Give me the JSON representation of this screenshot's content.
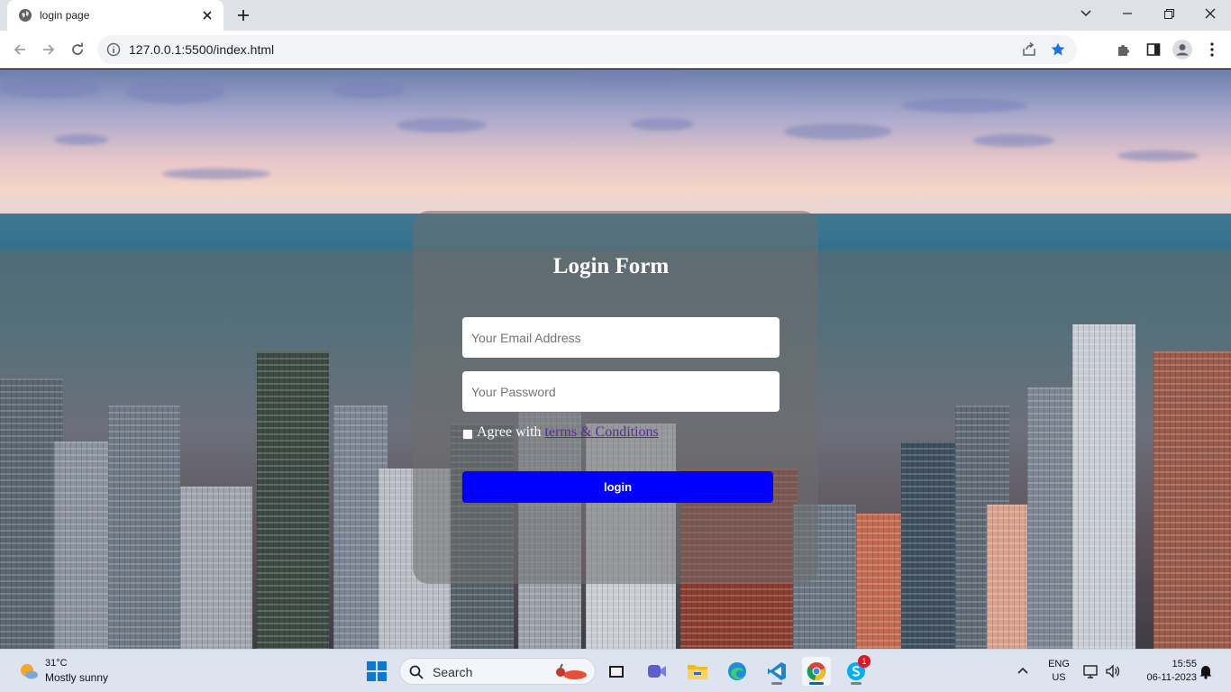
{
  "browser": {
    "tab_title": "login page",
    "url": "127.0.0.1:5500/index.html",
    "accent_star": "#1a73e8"
  },
  "login": {
    "title": "Login Form",
    "email_placeholder": "Your Email Address",
    "password_placeholder": "Your Password",
    "agree_text": "Agree with",
    "terms_link": "terms & Conditions",
    "button_label": "login",
    "button_color": "#0000ff",
    "card_color": "rgba(110,110,110,0.55)"
  },
  "taskbar": {
    "weather_temp": "31°C",
    "weather_desc": "Mostly sunny",
    "search_label": "Search",
    "apps": [
      "start-icon",
      "task-view-icon",
      "teams-meet-icon",
      "file-explorer-icon",
      "edge-icon",
      "vscode-icon",
      "chrome-icon",
      "skype-icon"
    ],
    "skype_badge": "1",
    "lang_line1": "ENG",
    "lang_line2": "US",
    "time": "15:55",
    "date": "06-11-2023"
  }
}
